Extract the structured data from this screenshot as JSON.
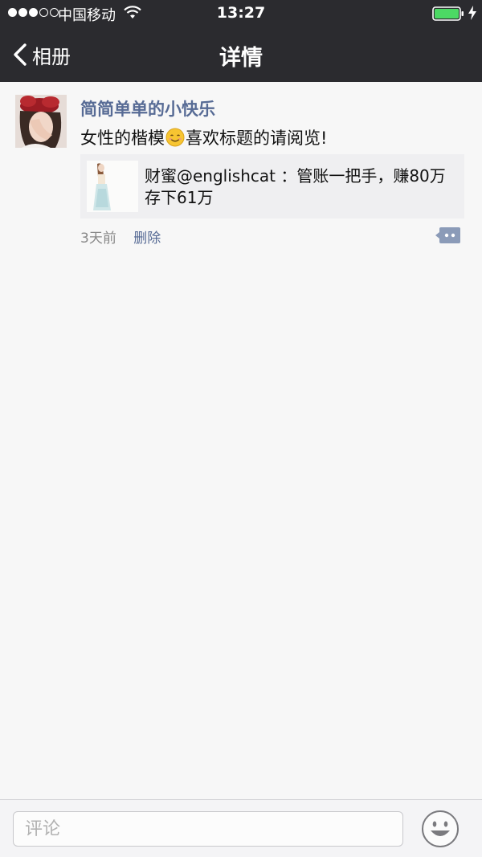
{
  "status_bar": {
    "carrier": "中国移动",
    "time": "13:27"
  },
  "nav": {
    "back_label": "相册",
    "title": "详情"
  },
  "post": {
    "author": "简简单单的小快乐",
    "text_before_emoji": "女性的楷模",
    "text_after_emoji": "喜欢标题的请阅览!",
    "share_title": "财蜜@englishcat ：管账一把手，赚80万存下61万",
    "time_ago": "3天前",
    "delete_label": "删除"
  },
  "comment_bar": {
    "placeholder": "评论"
  },
  "colors": {
    "bar_background": "#2b2b2f",
    "link_blue": "#576b95",
    "battery_green": "#4cd964",
    "page_background": "#f7f7f7"
  },
  "icons": [
    "signal-dots-icon",
    "wifi-icon",
    "battery-icon",
    "charge-icon",
    "back-chevron-icon",
    "smile-emoji-icon",
    "more-comment-icon",
    "emoji-face-icon"
  ]
}
